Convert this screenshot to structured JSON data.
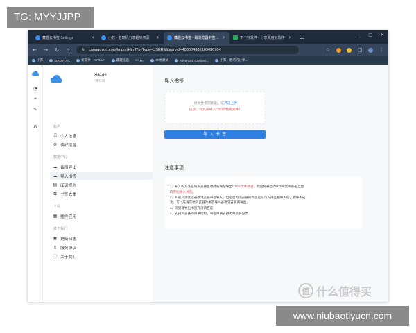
{
  "overlay": {
    "top_left_tag": "TG: MYYJJPP",
    "bottom_right_tag": "www.niubaotiyucn.com",
    "watermark_text": "什么值得买",
    "watermark_logo": "值"
  },
  "browser": {
    "tabs": [
      {
        "label": "藏趣云书签 Settings",
        "active": false,
        "icon": "cloud-favicon"
      },
      {
        "label": "小苏 - 老司机分享趣味资源",
        "active": false,
        "icon": "cloud-favicon"
      },
      {
        "label": "藏趣云书签 - 跨浏览器书签同步",
        "active": true,
        "icon": "cloud-favicon"
      },
      {
        "label": "下个好软件 - 分享实用好软件",
        "active": false,
        "icon": "green-favicon"
      }
    ],
    "new_tab": "+",
    "window_controls": [
      "—",
      "▢",
      "✕"
    ],
    "url": "cangquyun.com/importHtml?syType=USER&libraryId=486604602103496704",
    "bookmarks": [
      "小苏",
      "XIAOYI.VC",
      "好软件 - XYG.LA",
      "藏趣插画",
      "MT",
      "本地测试",
      "Advanced Customi...",
      "小苏 - 老司机分享..."
    ]
  },
  "rail": {
    "icons": [
      "cloud-logo-icon",
      "pie-chart-icon",
      "location-pin-icon",
      "edit-pen-icon",
      "settings-gear-icon"
    ]
  },
  "sidebar": {
    "user": {
      "name": "xia1ge",
      "status": "未订阅"
    },
    "sections": [
      {
        "title": "帐户",
        "items": [
          {
            "label": "个人信息",
            "icon": "user-icon"
          },
          {
            "label": "偏好设置",
            "icon": "gear-icon"
          }
        ]
      },
      {
        "title": "数据中心",
        "items": [
          {
            "label": "备份导出",
            "icon": "cloud-download-icon"
          },
          {
            "label": "导入书签",
            "icon": "cloud-upload-icon",
            "active": true
          },
          {
            "label": "阅读规则",
            "icon": "book-icon"
          },
          {
            "label": "书签去重",
            "icon": "copy-icon"
          }
        ]
      },
      {
        "title": "下载",
        "items": [
          {
            "label": "插件应用",
            "icon": "grid-icon"
          }
        ]
      },
      {
        "title": "关于我们",
        "items": [
          {
            "label": "更新日志",
            "icon": "log-icon"
          },
          {
            "label": "服务协议",
            "icon": "document-icon"
          },
          {
            "label": "关于我们",
            "icon": "info-icon"
          }
        ]
      }
    ]
  },
  "main": {
    "import_title": "导入书签",
    "upload_text": "将文件拖到此处，或",
    "upload_link": "点击上传",
    "upload_hint": "提示：仅允许导入\".html\"格式文件！",
    "import_button": "导 入 书 签",
    "notes_title": "注意事项",
    "notes": [
      {
        "pre": "1、导入的方法是将浏览器里收藏的网站导出",
        "hl": "HTML文件格式",
        "post": "，然后将导出的HTML文件点击上面"
      },
      {
        "pre": "的",
        "hl": "开始导入书签",
        "post": "。"
      },
      {
        "pre": "2、目前只测试过谷歌浏览器书签导入，但是因为浏览器的标签是可以支持互相导入的，如果不成",
        "hl": "",
        "post": ""
      },
      {
        "pre": "功，可以先将其他浏览器的书签导入谷歌浏览器再导出。",
        "hl": "",
        "post": ""
      },
      {
        "pre": "3、浏览器导出书签方法请百度",
        "hl": "",
        "post": ""
      },
      {
        "pre": "4、支持浏览器的目录结构，书签目录支持无限级别分类",
        "hl": "",
        "post": ""
      }
    ]
  },
  "colors": {
    "accent": "#2f7fe2",
    "warning": "#e25555",
    "browser_chrome": "#35465c"
  }
}
